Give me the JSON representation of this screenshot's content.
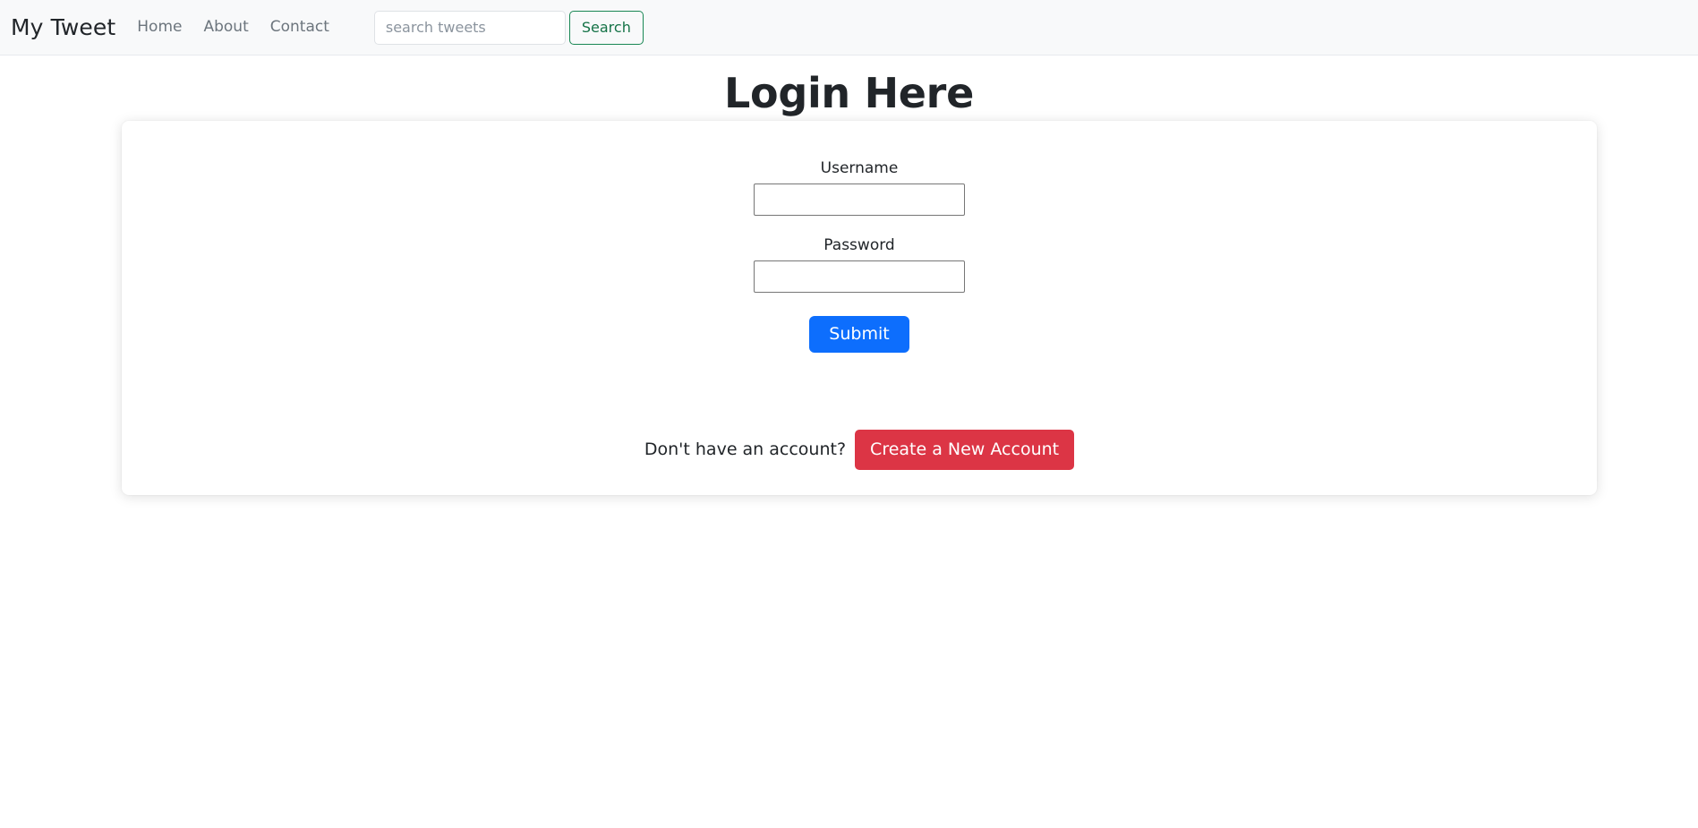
{
  "navbar": {
    "brand": "My Tweet",
    "links": [
      {
        "label": "Home"
      },
      {
        "label": "About"
      },
      {
        "label": "Contact"
      }
    ],
    "search": {
      "placeholder": "search tweets",
      "value": "",
      "button_label": "Search"
    }
  },
  "page": {
    "title": "Login Here"
  },
  "form": {
    "username": {
      "label": "Username",
      "value": "",
      "placeholder": ""
    },
    "password": {
      "label": "Password",
      "value": "",
      "placeholder": ""
    },
    "submit_label": "Submit"
  },
  "footer": {
    "prompt": "Don't have an account?",
    "create_account_label": "Create a New Account"
  },
  "colors": {
    "navbar_bg": "#f8f9fa",
    "primary": "#0d6efd",
    "danger": "#dc3545",
    "success_outline": "#198754",
    "text": "#212529",
    "muted": "#6c757d",
    "page_bg": "#ffffff"
  }
}
